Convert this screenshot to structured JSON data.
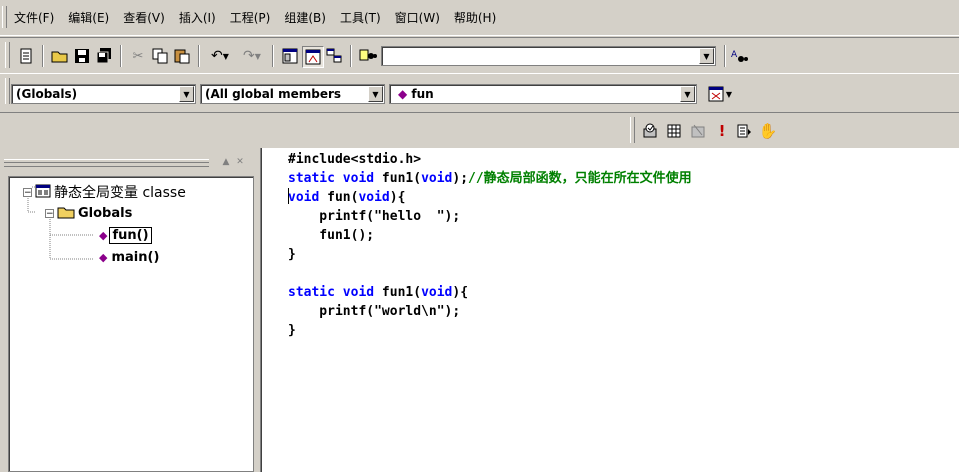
{
  "menu": [
    "文件(F)",
    "编辑(E)",
    "查看(V)",
    "插入(I)",
    "工程(P)",
    "组建(B)",
    "工具(T)",
    "窗口(W)",
    "帮助(H)"
  ],
  "toolbar": {
    "find_value": "",
    "icons": [
      "new-file-icon",
      "open-icon",
      "save-icon",
      "save-all-icon",
      "cut-icon",
      "copy-icon",
      "paste-icon",
      "undo-icon",
      "redo-icon",
      "workspace-icon",
      "output-icon",
      "window-list-icon",
      "find-in-files-icon",
      "find-icon"
    ]
  },
  "wizardbar": {
    "class_combo": "(Globals)",
    "filter_combo": "(All global members",
    "member_combo": "fun"
  },
  "buildbar": {
    "icons": [
      "compile-icon",
      "build-icon",
      "stop-build-icon",
      "execute-icon",
      "go-icon",
      "breakpoint-icon"
    ]
  },
  "classview": {
    "root": "静态全局变量 classe",
    "folder": "Globals",
    "items": [
      "fun()",
      "main()"
    ]
  },
  "editor": {
    "lines": [
      [
        {
          "t": "#include<stdio.h>",
          "c": "plain"
        }
      ],
      [
        {
          "t": "static void ",
          "c": "kw"
        },
        {
          "t": "fun1(",
          "c": "plain"
        },
        {
          "t": "void",
          "c": "kw"
        },
        {
          "t": ");",
          "c": "plain"
        },
        {
          "t": "//静态局部函数，只能在所在文件使用",
          "c": "cm"
        }
      ],
      [
        {
          "t": "void",
          "c": "kw"
        },
        {
          "t": " fun(",
          "c": "plain"
        },
        {
          "t": "void",
          "c": "kw"
        },
        {
          "t": "){",
          "c": "plain"
        }
      ],
      [
        {
          "t": "    printf(\"hello  \");",
          "c": "plain"
        }
      ],
      [
        {
          "t": "    fun1();",
          "c": "plain"
        }
      ],
      [
        {
          "t": "}",
          "c": "plain"
        }
      ],
      [
        {
          "t": "",
          "c": "plain"
        }
      ],
      [
        {
          "t": "static void ",
          "c": "kw"
        },
        {
          "t": "fun1(",
          "c": "plain"
        },
        {
          "t": "void",
          "c": "kw"
        },
        {
          "t": "){",
          "c": "plain"
        }
      ],
      [
        {
          "t": "    printf(\"world\\n\");",
          "c": "plain"
        }
      ],
      [
        {
          "t": "}",
          "c": "plain"
        }
      ]
    ]
  },
  "colors": {
    "keyword": "#0000ff",
    "comment": "#008000",
    "plain": "#000000",
    "member_icon": "#8b008b"
  }
}
